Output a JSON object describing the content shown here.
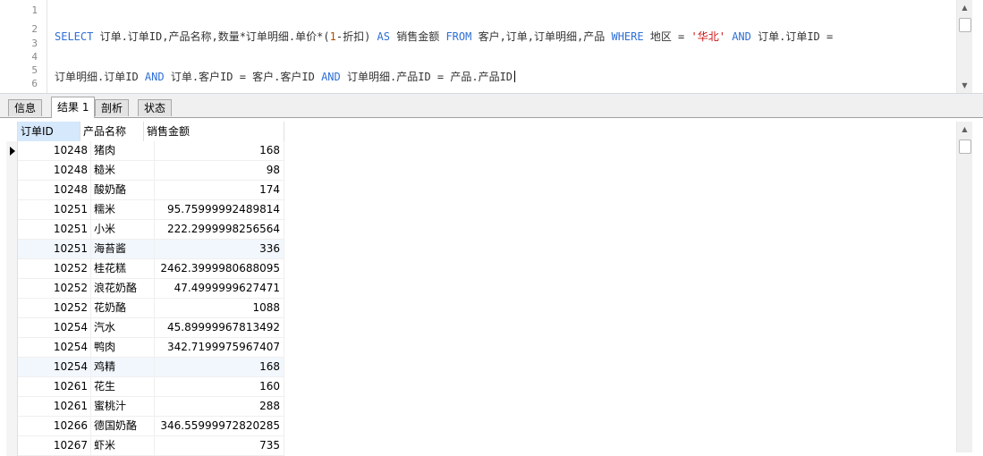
{
  "editor": {
    "line_numbers": [
      "1",
      "",
      "2",
      "3",
      "4",
      "5",
      "6"
    ],
    "sql": {
      "l1": [
        {
          "t": "SELECT",
          "c": "kw"
        },
        {
          "t": " 订单.订单ID,产品名称,数量*订单明细.单价*(",
          "c": ""
        },
        {
          "t": "1",
          "c": "num"
        },
        {
          "t": "-折扣) ",
          "c": ""
        },
        {
          "t": "AS",
          "c": "kw"
        },
        {
          "t": " 销售金额 ",
          "c": ""
        },
        {
          "t": "FROM",
          "c": "kw"
        },
        {
          "t": " 客户,订单,订单明细,产品 ",
          "c": ""
        },
        {
          "t": "WHERE",
          "c": "kw"
        },
        {
          "t": " 地区 = ",
          "c": ""
        },
        {
          "t": "'华北'",
          "c": "str"
        },
        {
          "t": " ",
          "c": ""
        },
        {
          "t": "AND",
          "c": "kw"
        },
        {
          "t": " 订单.订单ID =",
          "c": ""
        }
      ],
      "l2": [
        {
          "t": "订单明细.订单ID ",
          "c": ""
        },
        {
          "t": "AND",
          "c": "kw"
        },
        {
          "t": " 订单.客户ID = 客户.客户ID ",
          "c": ""
        },
        {
          "t": "AND",
          "c": "kw"
        },
        {
          "t": " 订单明细.产品ID = 产品.产品ID",
          "c": ""
        }
      ]
    }
  },
  "tabs": [
    {
      "label": "信息",
      "active": false
    },
    {
      "label": "结果 1",
      "active": true
    },
    {
      "label": "剖析",
      "active": false
    },
    {
      "label": "状态",
      "active": false
    }
  ],
  "grid": {
    "columns": [
      "订单ID",
      "产品名称",
      "销售金额"
    ],
    "rows": [
      {
        "id": "10248",
        "name": "猪肉",
        "amount": "168",
        "alt": false
      },
      {
        "id": "10248",
        "name": "糙米",
        "amount": "98",
        "alt": false
      },
      {
        "id": "10248",
        "name": "酸奶酪",
        "amount": "174",
        "alt": false
      },
      {
        "id": "10251",
        "name": "糯米",
        "amount": "95.75999992489814",
        "alt": false
      },
      {
        "id": "10251",
        "name": "小米",
        "amount": "222.2999998256564",
        "alt": false
      },
      {
        "id": "10251",
        "name": "海苔酱",
        "amount": "336",
        "alt": true
      },
      {
        "id": "10252",
        "name": "桂花糕",
        "amount": "2462.3999980688095",
        "alt": false
      },
      {
        "id": "10252",
        "name": "浪花奶酪",
        "amount": "47.4999999627471",
        "alt": false
      },
      {
        "id": "10252",
        "name": "花奶酪",
        "amount": "1088",
        "alt": false
      },
      {
        "id": "10254",
        "name": "汽水",
        "amount": "45.89999967813492",
        "alt": false
      },
      {
        "id": "10254",
        "name": "鸭肉",
        "amount": "342.7199975967407",
        "alt": false
      },
      {
        "id": "10254",
        "name": "鸡精",
        "amount": "168",
        "alt": true
      },
      {
        "id": "10261",
        "name": "花生",
        "amount": "160",
        "alt": false
      },
      {
        "id": "10261",
        "name": "蜜桃汁",
        "amount": "288",
        "alt": false
      },
      {
        "id": "10266",
        "name": "德国奶酪",
        "amount": "346.55999972820285",
        "alt": false
      },
      {
        "id": "10267",
        "name": "虾米",
        "amount": "735",
        "alt": false
      }
    ]
  }
}
